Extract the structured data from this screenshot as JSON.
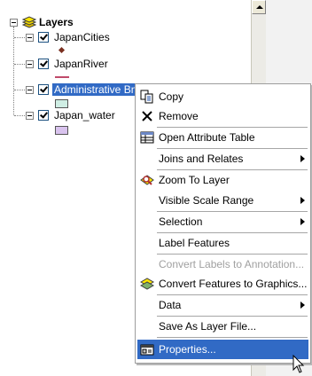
{
  "toc": {
    "root_label": "Layers",
    "layers": [
      {
        "name": "JapanCities",
        "symbol": "point",
        "color": "#7a3020"
      },
      {
        "name": "JapanRiver",
        "symbol": "line",
        "color": "#c04a6a"
      },
      {
        "name": "Administrative Bnds",
        "symbol": "polygon",
        "color": "#cfeee4",
        "selected": true
      },
      {
        "name": "Japan_water",
        "symbol": "polygon",
        "color": "#d9c3ee"
      }
    ]
  },
  "menu": {
    "items": [
      {
        "label": "Copy",
        "icon": "copy-icon"
      },
      {
        "label": "Remove",
        "icon": "remove-icon"
      },
      {
        "label": "Open Attribute Table",
        "icon": "table-icon"
      },
      {
        "label": "Joins and Relates",
        "submenu": true
      },
      {
        "label": "Zoom To Layer",
        "icon": "zoom-to-layer-icon"
      },
      {
        "label": "Visible Scale Range",
        "submenu": true
      },
      {
        "label": "Selection",
        "submenu": true
      },
      {
        "label": "Label Features"
      },
      {
        "label": "Convert Labels to Annotation...",
        "disabled": true
      },
      {
        "label": "Convert Features to Graphics...",
        "icon": "convert-graphics-icon"
      },
      {
        "label": "Data",
        "submenu": true
      },
      {
        "label": "Save As Layer File..."
      },
      {
        "label": "Properties...",
        "icon": "properties-icon",
        "highlighted": true
      }
    ]
  },
  "colors": {
    "selection": "#316ac5",
    "menu_border": "#9d9d9d"
  }
}
